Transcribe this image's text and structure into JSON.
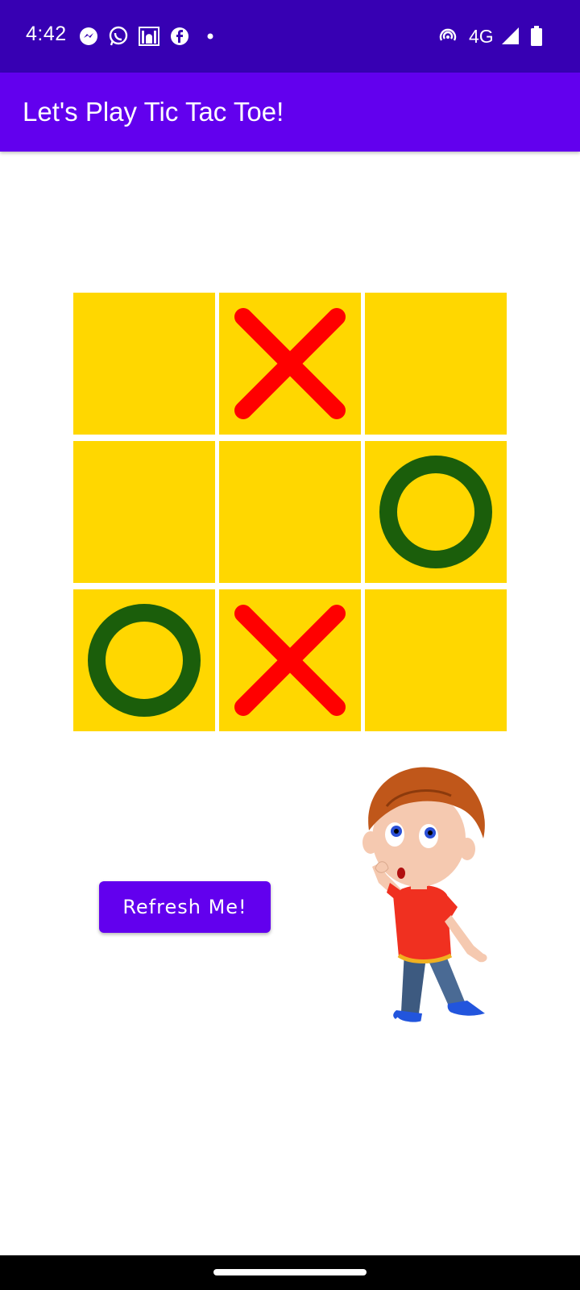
{
  "status_bar": {
    "time": "4:42",
    "network": "4G",
    "left_icons": [
      "messenger-icon",
      "whatsapp-icon",
      "mosque-icon",
      "facebook-icon",
      "dot-icon"
    ],
    "right_icons": [
      "hotspot-icon",
      "signal-icon",
      "battery-icon"
    ]
  },
  "app_bar": {
    "title": "Let's Play Tic Tac Toe!"
  },
  "board": {
    "cells": [
      "",
      "X",
      "",
      "",
      "",
      "O",
      "O",
      "X",
      ""
    ]
  },
  "refresh_button": {
    "label": "Refresh Me!"
  },
  "colors": {
    "status_bar": "#3700B3",
    "app_bar": "#6200EE",
    "cell": "#FFD700",
    "x_mark": "#FF0000",
    "o_mark": "#1B5E0B",
    "button": "#6200EE"
  },
  "illustration": "thinking-boy-cartoon"
}
